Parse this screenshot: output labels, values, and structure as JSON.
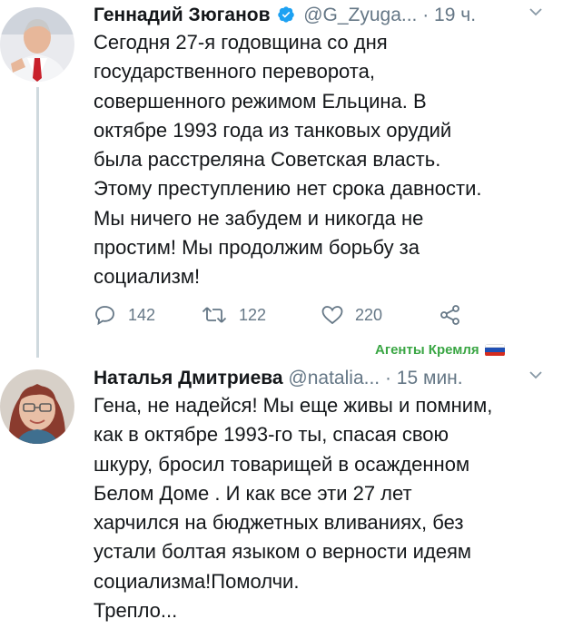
{
  "tweets": [
    {
      "author": "Геннадий Зюганов",
      "handle": "@G_Zyuga...",
      "time": "· 19 ч.",
      "verified": true,
      "text": "Сегодня 27-я годовщина со дня\nгосударственного переворота,\nсовершенного режимом Ельцина. В\nоктябре 1993 года из танковых орудий\nбыла расстреляна Советская власть.\nЭтому преступлению нет срока давности.\nМы ничего не забудем и никогда не\nпростим! Мы продолжим борьбу за\nсоциализм!",
      "replies": "142",
      "retweets": "122",
      "likes": "220"
    },
    {
      "author": "Наталья Дмитриева",
      "handle": "@natalia...",
      "time": "· 15 мин.",
      "verified": false,
      "text": "Гена, не надейся! Мы еще живы и помним,\nкак в октябре 1993-го ты,  спасая свою\nшкуру, бросил  товарищей в осажденном\nБелом Доме . И как все эти 27 лет\nхарчился на бюджетных вливаниях, без\nустали болтая языком о верности идеям\nсоциализма!Помолчи.\nТрепло..."
    }
  ],
  "watermark": {
    "text": "Агенты Кремля",
    "color": "#3aa644"
  },
  "colors": {
    "text": "#14171a",
    "secondary": "#657786",
    "verified": "#1da1f2",
    "thread_line": "#cfd9de"
  }
}
